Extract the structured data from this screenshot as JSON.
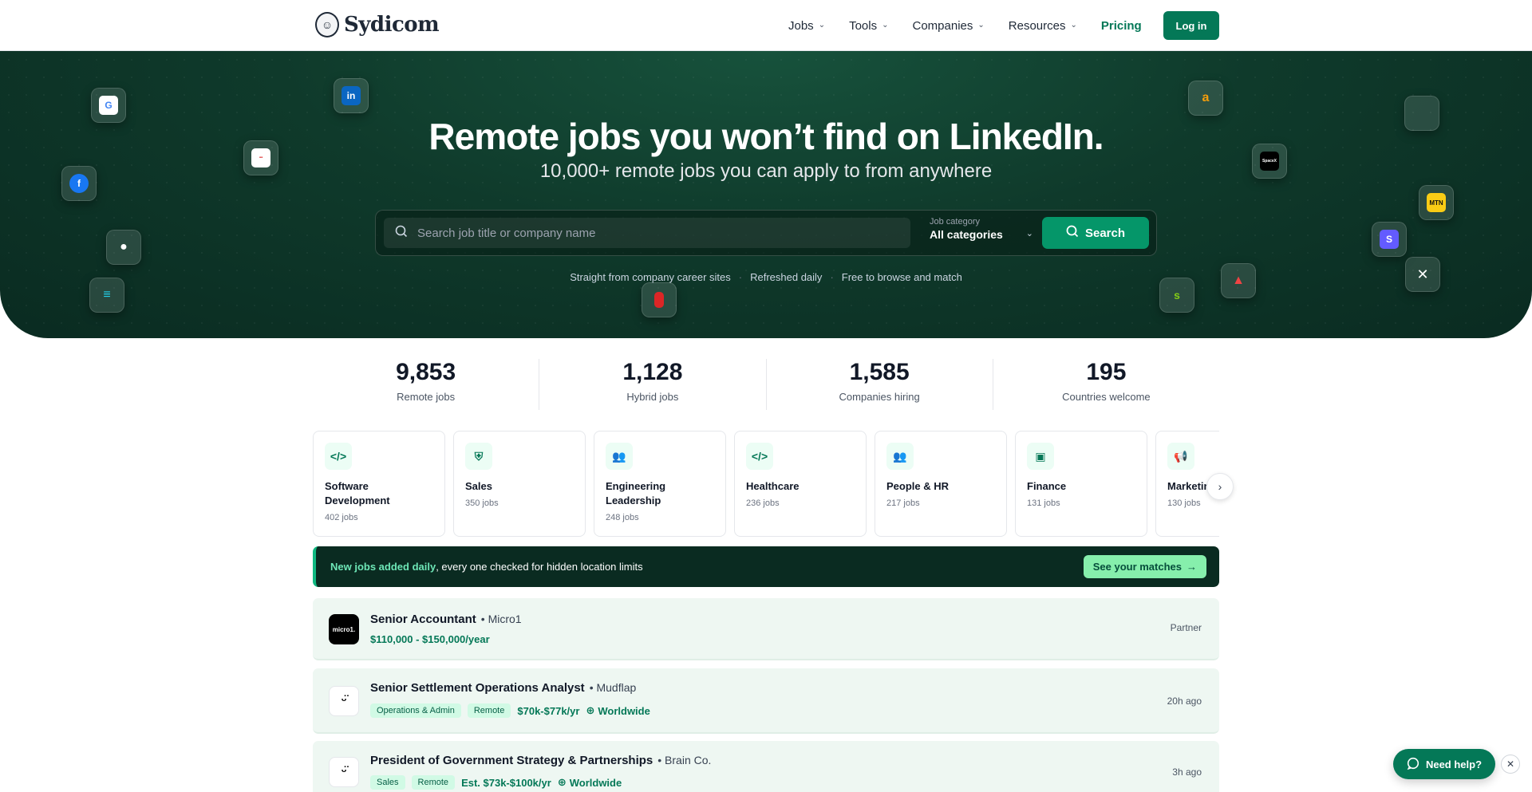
{
  "nav": {
    "brand": "Sydicom",
    "links": [
      {
        "label": "Jobs"
      },
      {
        "label": "Tools"
      },
      {
        "label": "Companies"
      },
      {
        "label": "Resources"
      }
    ],
    "pricing_label": "Pricing",
    "login_label": "Log in"
  },
  "hero": {
    "title": "Remote jobs you won’t find on LinkedIn.",
    "subtitle": "10,000+ remote jobs you can apply to from anywhere",
    "search_placeholder": "Search job title or company name",
    "category_label": "Job category",
    "category_value": "All categories",
    "search_button": "Search",
    "facts": [
      "Straight from company career sites",
      "Refreshed daily",
      "Free to browse and match"
    ],
    "floating_logos": [
      "google",
      "linkedin",
      "facebook",
      "indeed",
      "apple",
      "unknown-blue",
      "unknown-red",
      "amazon",
      "microsoft",
      "spacex",
      "mtn",
      "stripe",
      "x",
      "adobe",
      "shopify"
    ]
  },
  "stats": [
    {
      "value": "9,853",
      "label": "Remote jobs"
    },
    {
      "value": "1,128",
      "label": "Hybrid jobs"
    },
    {
      "value": "1,585",
      "label": "Companies hiring"
    },
    {
      "value": "195",
      "label": "Countries welcome"
    }
  ],
  "categories": [
    {
      "name": "Software Development",
      "count": "402 jobs",
      "icon": "code-icon"
    },
    {
      "name": "Sales",
      "count": "350 jobs",
      "icon": "handshake-icon"
    },
    {
      "name": "Engineering Leadership",
      "count": "248 jobs",
      "icon": "people-icon"
    },
    {
      "name": "Healthcare",
      "count": "236 jobs",
      "icon": "code-icon"
    },
    {
      "name": "People & HR",
      "count": "217 jobs",
      "icon": "people-icon"
    },
    {
      "name": "Finance",
      "count": "131 jobs",
      "icon": "money-icon"
    },
    {
      "name": "Marketing",
      "count": "130 jobs",
      "icon": "megaphone-icon"
    }
  ],
  "banner": {
    "highlight": "New jobs added daily",
    "rest": ", every one checked for hidden location limits",
    "button": "See your matches"
  },
  "jobs": [
    {
      "title": "Senior Accountant",
      "company": "• Micro1",
      "salary": "$110,000 - $150,000/year",
      "right": "Partner",
      "logo_text": "micro1."
    },
    {
      "title": "Senior Settlement Operations Analyst",
      "company": "• Mudflap",
      "tags": [
        "Operations & Admin",
        "Remote"
      ],
      "salary": "$70k-$77k/yr",
      "location": "Worldwide",
      "right": "20h ago",
      "logo_text": "ᵕ̈"
    },
    {
      "title": "President of Government Strategy & Partnerships",
      "company": "• Brain Co.",
      "tags": [
        "Sales",
        "Remote"
      ],
      "salary": "Est. $73k-$100k/yr",
      "location": "Worldwide",
      "right": "3h ago",
      "logo_text": "ᵕ̈"
    }
  ],
  "help": {
    "label": "Need help?"
  },
  "colors": {
    "brand": "#047857",
    "hero_bg": "#0f3a2b",
    "accent_light": "#86efac"
  }
}
